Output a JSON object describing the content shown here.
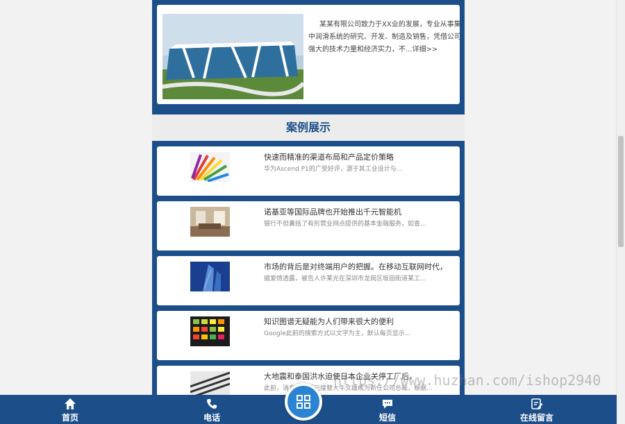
{
  "about": {
    "text": "某某有限公司致力于XX业的发展，专业从事集中润滑系统的研究、开发、制造及销售，凭借公司强大的技术力量和经济实力，不...详细>>"
  },
  "cases": {
    "title": "案例展示",
    "items": [
      {
        "title": "快速而精准的渠道布局和产品定价策略",
        "desc": "华为Ascend P1的广受好评，源于其工业设计与..."
      },
      {
        "title": "诺基亚等国际品牌也开始推出千元智能机",
        "desc": "银行不但囊括了有形营业网点提供的基本金融服务，如查..."
      },
      {
        "title": "市场的背后是对终端用户的把握。在移动互联网时代，",
        "desc": "据爱情透露，被告人许某光在深圳市龙岗区坂田街道某工..."
      },
      {
        "title": "知识图谱无疑能为人们带来很大的便利",
        "desc": "Google此前的搜索方式以文字为主，默认每页显示..."
      },
      {
        "title": "大地震和泰国洪水迫使日本企业关停工厂后，",
        "desc": "此前，消息称苹果已接替大牛文雄成为新任公司总裁，根据..."
      }
    ]
  },
  "bottom_nav": {
    "home": "首页",
    "phone": "电话",
    "sms": "短信",
    "message": "在线留言"
  },
  "watermark": "https://www.huzhan.com/ishop2940",
  "colors": {
    "brand_blue": "#1c4e8a",
    "accent": "#2b83d3"
  }
}
